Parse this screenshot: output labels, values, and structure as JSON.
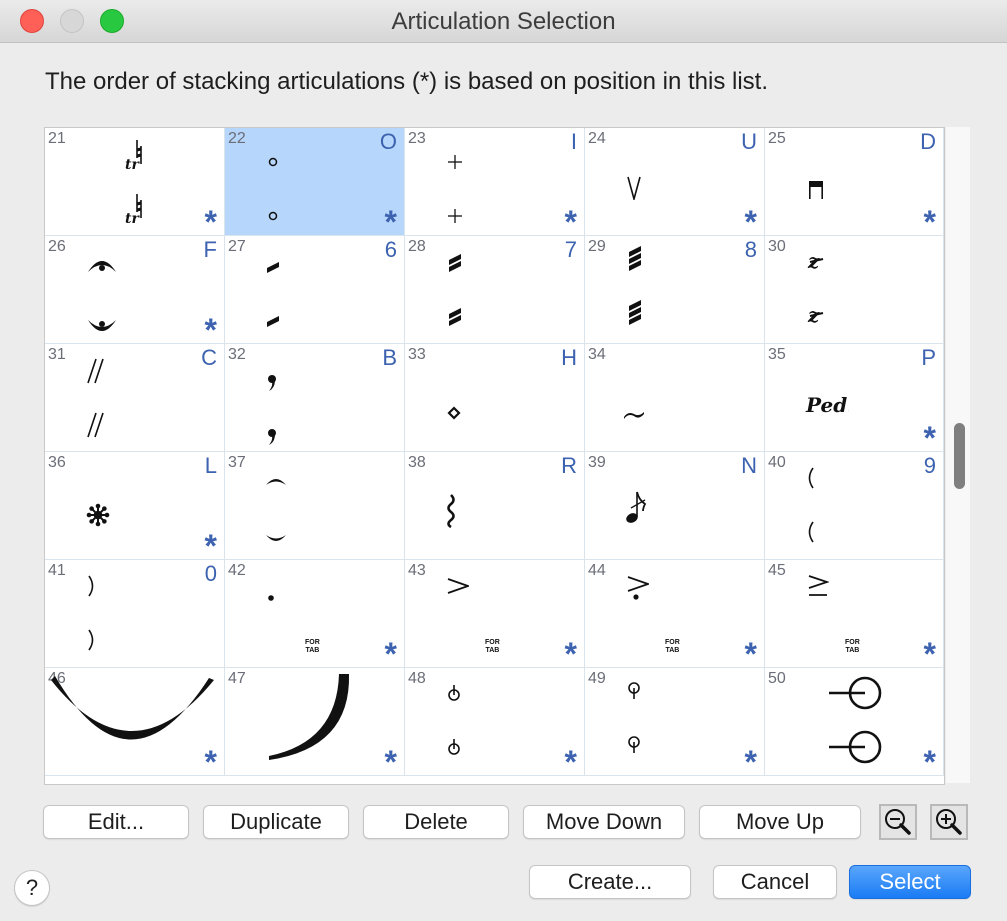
{
  "window": {
    "title": "Articulation Selection"
  },
  "instruction": "The order of stacking articulations (*) is based on position in this list.",
  "selected_index": 22,
  "accent_color": "#3c62b0",
  "selection_color": "#b6d6fb",
  "articulations": [
    {
      "num": "21",
      "key": "",
      "stacking": true,
      "symbol": "trill-natural",
      "glyph_top": "♮tr",
      "glyph_bottom": "♮tr"
    },
    {
      "num": "22",
      "key": "O",
      "stacking": true,
      "symbol": "harmonic-circle",
      "glyph_top": "∘",
      "glyph_bottom": "∘",
      "selected": true
    },
    {
      "num": "23",
      "key": "I",
      "stacking": true,
      "symbol": "stopped-plus",
      "glyph_top": "+",
      "glyph_bottom": "+"
    },
    {
      "num": "24",
      "key": "U",
      "stacking": true,
      "symbol": "up-bow",
      "glyph_top": "V",
      "glyph_bottom": ""
    },
    {
      "num": "25",
      "key": "D",
      "stacking": true,
      "symbol": "down-bow",
      "glyph_top": "▀",
      "glyph_bottom": ""
    },
    {
      "num": "26",
      "key": "F",
      "stacking": true,
      "symbol": "fermata",
      "glyph_top": "𝄐",
      "glyph_bottom": "𝄑"
    },
    {
      "num": "27",
      "key": "6",
      "stacking": false,
      "symbol": "tremolo-1",
      "glyph_top": "▰",
      "glyph_bottom": "▰"
    },
    {
      "num": "28",
      "key": "7",
      "stacking": false,
      "symbol": "tremolo-2",
      "glyph_top": "≡",
      "glyph_bottom": "≡"
    },
    {
      "num": "29",
      "key": "8",
      "stacking": false,
      "symbol": "tremolo-3",
      "glyph_top": "≣",
      "glyph_bottom": "≣"
    },
    {
      "num": "30",
      "key": "",
      "stacking": false,
      "symbol": "buzz-roll-z",
      "glyph_top": "z",
      "glyph_bottom": "z"
    },
    {
      "num": "31",
      "key": "C",
      "stacking": false,
      "symbol": "caesura",
      "glyph_top": "//",
      "glyph_bottom": "//"
    },
    {
      "num": "32",
      "key": "B",
      "stacking": false,
      "symbol": "breath-mark",
      "glyph_top": ",",
      "glyph_bottom": ","
    },
    {
      "num": "33",
      "key": "H",
      "stacking": false,
      "symbol": "harmonic-diamond",
      "glyph_top": "",
      "glyph_bottom": "◇"
    },
    {
      "num": "34",
      "key": "",
      "stacking": false,
      "symbol": "turn-tilde",
      "glyph_top": "",
      "glyph_bottom": "~"
    },
    {
      "num": "35",
      "key": "P",
      "stacking": true,
      "symbol": "pedal",
      "glyph_top": "Ped.",
      "glyph_bottom": ""
    },
    {
      "num": "36",
      "key": "L",
      "stacking": true,
      "symbol": "pedal-release",
      "glyph_top": "❋",
      "glyph_bottom": ""
    },
    {
      "num": "37",
      "key": "",
      "stacking": false,
      "symbol": "arc",
      "glyph_top": "⌒",
      "glyph_bottom": "‿"
    },
    {
      "num": "38",
      "key": "R",
      "stacking": false,
      "symbol": "arpeggio-wave",
      "glyph_top": "≀",
      "glyph_bottom": ""
    },
    {
      "num": "39",
      "key": "N",
      "stacking": false,
      "symbol": "grace-note",
      "glyph_top": "♪",
      "glyph_bottom": ""
    },
    {
      "num": "40",
      "key": "9",
      "stacking": false,
      "symbol": "left-paren",
      "glyph_top": "(",
      "glyph_bottom": "("
    },
    {
      "num": "41",
      "key": "0",
      "stacking": false,
      "symbol": "right-paren",
      "glyph_top": ")",
      "glyph_bottom": ")"
    },
    {
      "num": "42",
      "key": "",
      "stacking": true,
      "symbol": "staccato-tab",
      "glyph_top": "•",
      "glyph_bottom": "",
      "tab_label": [
        "FOR",
        "TAB"
      ]
    },
    {
      "num": "43",
      "key": "",
      "stacking": true,
      "symbol": "accent-tab",
      "glyph_top": ">",
      "glyph_bottom": "",
      "tab_label": [
        "FOR",
        "TAB"
      ]
    },
    {
      "num": "44",
      "key": "",
      "stacking": true,
      "symbol": "accent-staccato-tab",
      "glyph_top": ">",
      "glyph_bottom": "",
      "tab_label": [
        "FOR",
        "TAB"
      ]
    },
    {
      "num": "45",
      "key": "",
      "stacking": true,
      "symbol": "accent-tenuto-tab",
      "glyph_top": "≥",
      "glyph_bottom": "",
      "tab_label": [
        "FOR",
        "TAB"
      ]
    },
    {
      "num": "46",
      "key": "",
      "stacking": true,
      "symbol": "slur-arc",
      "glyph_top": "",
      "glyph_bottom": ""
    },
    {
      "num": "47",
      "key": "",
      "stacking": true,
      "symbol": "fall-curve",
      "glyph_top": "",
      "glyph_bottom": ""
    },
    {
      "num": "48",
      "key": "",
      "stacking": true,
      "symbol": "open-stem-circle",
      "glyph_top": "⏀",
      "glyph_bottom": "⏀"
    },
    {
      "num": "49",
      "key": "",
      "stacking": true,
      "symbol": "closed-stem-circle",
      "glyph_top": "φ",
      "glyph_bottom": "φ"
    },
    {
      "num": "50",
      "key": "",
      "stacking": true,
      "symbol": "half-open-circle",
      "glyph_top": "",
      "glyph_bottom": ""
    }
  ],
  "star_glyph": "*",
  "toolbar": {
    "edit": "Edit...",
    "duplicate": "Duplicate",
    "delete": "Delete",
    "move_down": "Move Down",
    "move_up": "Move Up",
    "zoom_out_icon": "zoom-out-icon",
    "zoom_in_icon": "zoom-in-icon"
  },
  "footer": {
    "help": "?",
    "create": "Create...",
    "cancel": "Cancel",
    "select": "Select"
  }
}
